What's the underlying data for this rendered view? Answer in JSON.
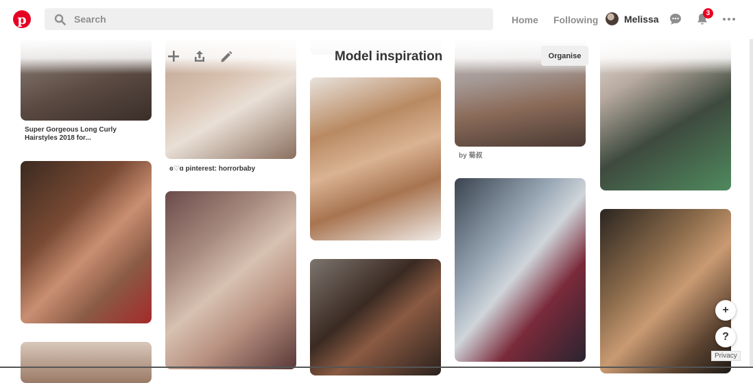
{
  "header": {
    "search_placeholder": "Search",
    "nav": {
      "home": "Home",
      "following": "Following"
    },
    "user_name": "Melissa",
    "notification_count": "3"
  },
  "board": {
    "title": "Model inspiration",
    "organise_label": "Organise"
  },
  "pins": {
    "p1_caption": "Super Gorgeous Long Curly Hairstyles 2018 for...",
    "p2_caption": "ɞ♡ɑ pinterest: horrorbaby",
    "p3_caption": "by 菊叔"
  },
  "footer": {
    "privacy_label": "Privacy",
    "help_label": "?",
    "add_label": "+"
  },
  "colors": {
    "brand": "#e60023",
    "search_bg": "#efefef",
    "muted_text": "#8e8e8e"
  },
  "icons": [
    "pinterest-logo-icon",
    "search-icon",
    "chat-icon",
    "bell-icon",
    "more-icon",
    "add-icon",
    "share-icon",
    "edit-icon"
  ]
}
